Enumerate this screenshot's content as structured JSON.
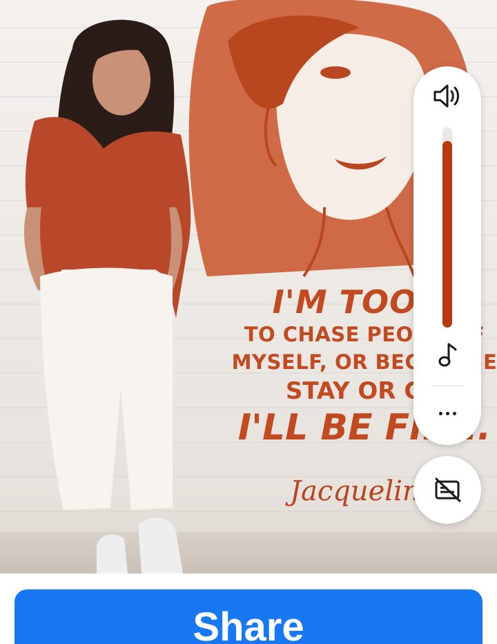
{
  "image": {
    "alt_subject": "woman-in-front-of-mural"
  },
  "mural": {
    "line1": "I'M TOO O",
    "line2": "TO CHASE PEOPLE, F",
    "line3": "MYSELF, OR BEG TO BE",
    "line4": "STAY OR GO",
    "line5": "I'LL BE FINE.",
    "signature": "Jacqueline"
  },
  "volume_panel": {
    "icons": [
      "speaker-icon",
      "music-note-icon",
      "more-options-icon"
    ],
    "level": 0.93,
    "fill_color": "#b83a0c"
  },
  "caption_button": {
    "icon": "captions-off-icon"
  },
  "share_button": {
    "label": "Share",
    "color": "#1877f2"
  }
}
